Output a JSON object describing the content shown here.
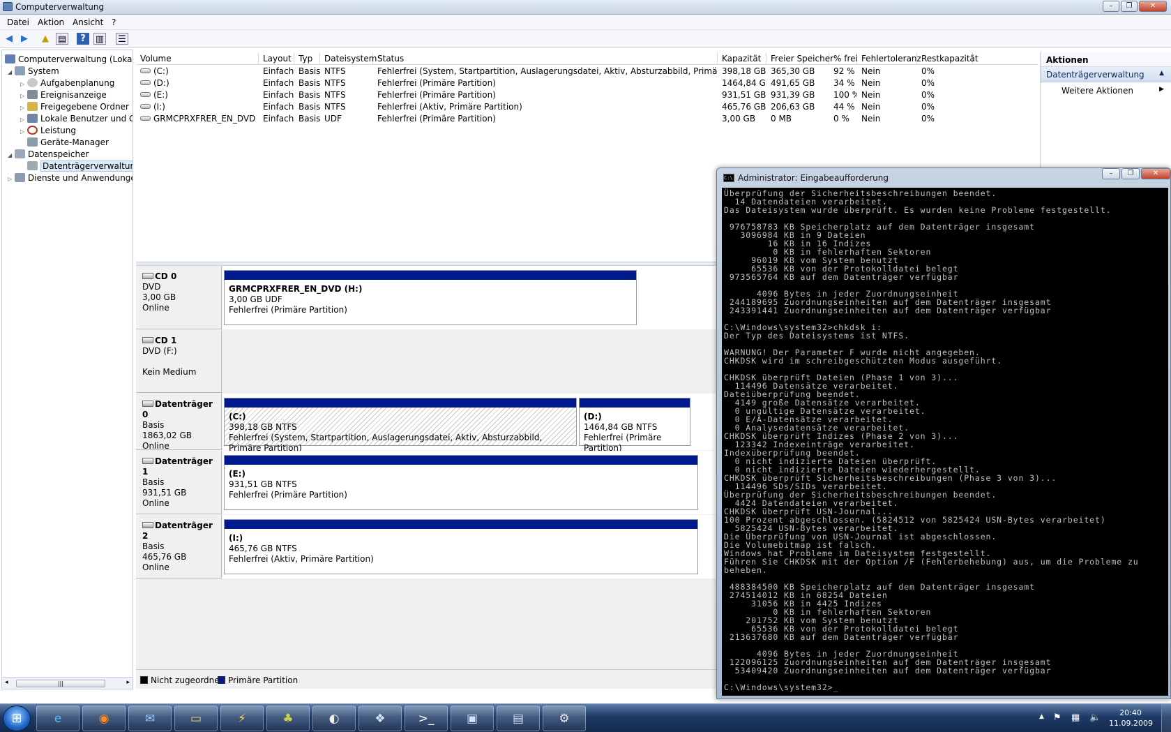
{
  "window": {
    "title": "Computerverwaltung"
  },
  "menu": [
    "Datei",
    "Aktion",
    "Ansicht",
    "?"
  ],
  "tree": [
    {
      "label": "Computerverwaltung (Lokal)",
      "icon": "computer-icon"
    },
    {
      "label": "System",
      "icon": "tools-icon"
    },
    {
      "label": "Aufgabenplanung",
      "icon": "clock-icon"
    },
    {
      "label": "Ereignisanzeige",
      "icon": "event-viewer-icon"
    },
    {
      "label": "Freigegebene Ordner",
      "icon": "shared-folder-icon"
    },
    {
      "label": "Lokale Benutzer und Gr",
      "icon": "users-icon"
    },
    {
      "label": "Leistung",
      "icon": "performance-icon"
    },
    {
      "label": "Geräte-Manager",
      "icon": "device-manager-icon"
    },
    {
      "label": "Datenspeicher",
      "icon": "storage-icon"
    },
    {
      "label": "Datenträgerverwaltung",
      "icon": "disk-management-icon"
    },
    {
      "label": "Dienste und Anwendungen",
      "icon": "services-icon"
    }
  ],
  "volumes": {
    "headers": [
      "Volume",
      "Layout",
      "Typ",
      "Dateisystem",
      "Status",
      "Kapazität",
      "Freier Speicher",
      "% frei",
      "Fehlertoleranz",
      "Restkapazität"
    ],
    "rows": [
      [
        "(C:)",
        "Einfach",
        "Basis",
        "NTFS",
        "Fehlerfrei (System, Startpartition, Auslagerungsdatei, Aktiv, Absturzabbild, Primäre Partition)",
        "398,18 GB",
        "365,30 GB",
        "92 %",
        "Nein",
        "0%"
      ],
      [
        "(D:)",
        "Einfach",
        "Basis",
        "NTFS",
        "Fehlerfrei (Primäre Partition)",
        "1464,84 GB",
        "491,65 GB",
        "34 %",
        "Nein",
        "0%"
      ],
      [
        "(E:)",
        "Einfach",
        "Basis",
        "NTFS",
        "Fehlerfrei (Primäre Partition)",
        "931,51 GB",
        "931,39 GB",
        "100 %",
        "Nein",
        "0%"
      ],
      [
        "(I:)",
        "Einfach",
        "Basis",
        "NTFS",
        "Fehlerfrei (Aktiv, Primäre Partition)",
        "465,76 GB",
        "206,63 GB",
        "44 %",
        "Nein",
        "0%"
      ],
      [
        "GRMCPRXFRER_EN_DVD (H:)",
        "Einfach",
        "Basis",
        "UDF",
        "Fehlerfrei (Primäre Partition)",
        "3,00 GB",
        "0 MB",
        "0 %",
        "Nein",
        "0%"
      ]
    ]
  },
  "disks": [
    {
      "name": "CD 0",
      "l1": "DVD",
      "l2": "3,00 GB",
      "l3": "Online",
      "parts": [
        {
          "title": "GRMCPRXFRER_EN_DVD  (H:)",
          "size": "3,00 GB UDF",
          "status": "Fehlerfrei (Primäre Partition)"
        }
      ]
    },
    {
      "name": "CD 1",
      "l1": "DVD (F:)",
      "l2": "",
      "l3": "Kein Medium",
      "parts": []
    },
    {
      "name": "Datenträger 0",
      "l1": "Basis",
      "l2": "1863,02 GB",
      "l3": "Online",
      "parts": [
        {
          "title": "(C:)",
          "size": "398,18 GB NTFS",
          "status": "Fehlerfrei (System, Startpartition, Auslagerungsdatei, Aktiv, Absturzabbild, Primäre Partition)"
        },
        {
          "title": "(D:)",
          "size": "1464,84 GB NTFS",
          "status": "Fehlerfrei (Primäre Partition)"
        }
      ]
    },
    {
      "name": "Datenträger 1",
      "l1": "Basis",
      "l2": "931,51 GB",
      "l3": "Online",
      "parts": [
        {
          "title": "(E:)",
          "size": "931,51 GB NTFS",
          "status": "Fehlerfrei (Primäre Partition)"
        }
      ]
    },
    {
      "name": "Datenträger 2",
      "l1": "Basis",
      "l2": "465,76 GB",
      "l3": "Online",
      "parts": [
        {
          "title": "(I:)",
          "size": "465,76 GB NTFS",
          "status": "Fehlerfrei (Aktiv, Primäre Partition)"
        }
      ]
    }
  ],
  "legend": [
    {
      "label": "Nicht zugeordnet",
      "color": "#000000"
    },
    {
      "label": "Primäre Partition",
      "color": "#001a8e"
    }
  ],
  "actions": {
    "header": "Aktionen",
    "section": "Datenträgerverwaltung",
    "more": "Weitere Aktionen"
  },
  "cmd": {
    "title": "Administrator: Eingabeaufforderung",
    "text": "Überprüfung der Sicherheitsbeschreibungen beendet.\n  14 Datendateien verarbeitet.\nDas Dateisystem wurde überprüft. Es wurden keine Probleme festgestellt.\n\n 976758783 KB Speicherplatz auf dem Datenträger insgesamt\n   3096984 KB in 9 Dateien\n        16 KB in 16 Indizes\n         0 KB in fehlerhaften Sektoren\n     96019 KB vom System benutzt\n     65536 KB von der Protokolldatei belegt\n 973565764 KB auf dem Datenträger verfügbar\n\n      4096 Bytes in jeder Zuordnungseinheit\n 244189695 Zuordnungseinheiten auf dem Datenträger insgesamt\n 243391441 Zuordnungseinheiten auf dem Datenträger verfügbar\n\nC:\\Windows\\system32>chkdsk i:\nDer Typ des Dateisystems ist NTFS.\n\nWARNUNG! Der Parameter F wurde nicht angegeben.\nCHKDSK wird im schreibgeschützten Modus ausgeführt.\n\nCHKDSK überprüft Dateien (Phase 1 von 3)...\n  114496 Datensätze verarbeitet.\nDateiüberprüfung beendet.\n  4149 große Datensätze verarbeitet.\n  0 ungültige Datensätze verarbeitet.\n  0 E/A-Datensätze verarbeitet.\n  0 Analysedatensätze verarbeitet.\nCHKDSK überprüft Indizes (Phase 2 von 3)...\n  123342 Indexeinträge verarbeitet.\nIndexüberprüfung beendet.\n  0 nicht indizierte Dateien überprüft.\n  0 nicht indizierte Dateien wiederhergestellt.\nCHKDSK überprüft Sicherheitsbeschreibungen (Phase 3 von 3)...\n  114496 SDs/SIDs verarbeitet.\nÜberprüfung der Sicherheitsbeschreibungen beendet.\n  4424 Datendateien verarbeitet.\nCHKDSK überprüft USN-Journal...\n100 Prozent abgeschlossen. (5824512 von 5825424 USN-Bytes verarbeitet)\n  5825424 USN-Bytes verarbeitet.\nDie Überprüfung von USN-Journal ist abgeschlossen.\nDie Volumebitmap ist falsch.\nWindows hat Probleme im Dateisystem festgestellt.\nFühren Sie CHKDSK mit der Option /F (Fehlerbehebung) aus, um die Probleme zu\nbeheben.\n\n 488384500 KB Speicherplatz auf dem Datenträger insgesamt\n 274514012 KB in 68254 Dateien\n     31056 KB in 4425 Indizes\n         0 KB in fehlerhaften Sektoren\n    201752 KB vom System benutzt\n     65536 KB von der Protokolldatei belegt\n 213637680 KB auf dem Datenträger verfügbar\n\n      4096 Bytes in jeder Zuordnungseinheit\n 122096125 Zuordnungseinheiten auf dem Datenträger insgesamt\n  53409420 Zuordnungseinheiten auf dem Datenträger verfügbar\n\nC:\\Windows\\system32>_"
  },
  "taskbar": {
    "apps": [
      "internet-explorer-icon",
      "firefox-icon",
      "thunderbird-icon",
      "explorer-folder-icon",
      "winamp-icon",
      "puzzle-app-icon",
      "media-player-icon",
      "messenger-icon",
      "command-prompt-icon",
      "computer-management-icon",
      "network-icon",
      "utility-icon"
    ],
    "time": "20:40",
    "date": "11.09.2009"
  }
}
